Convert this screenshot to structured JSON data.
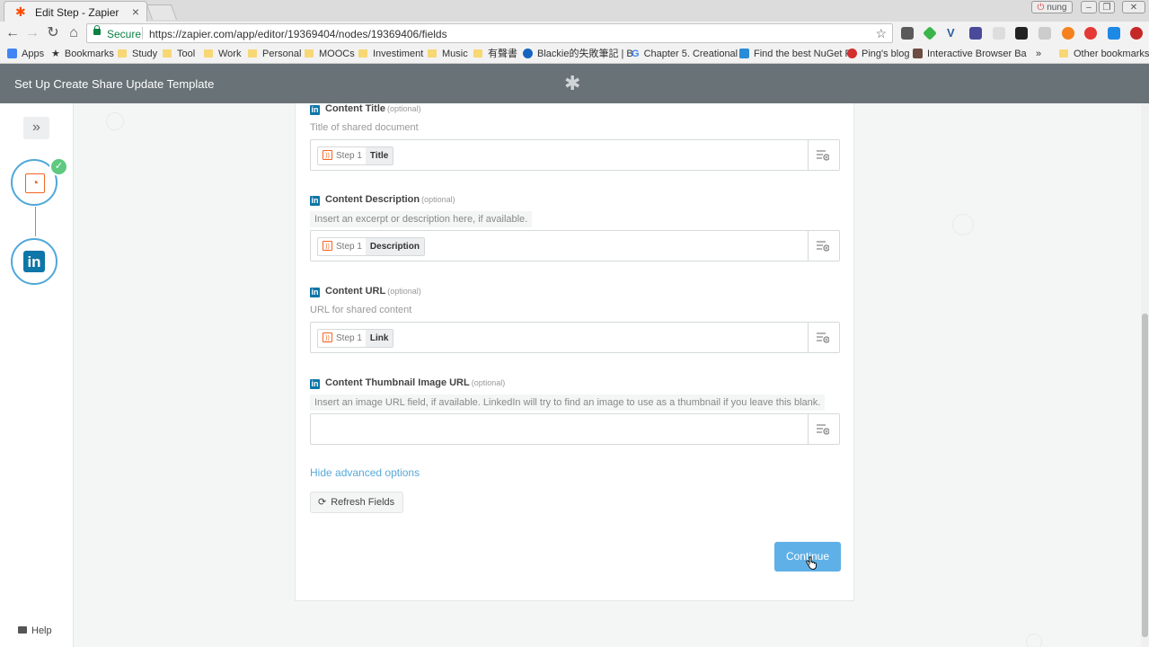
{
  "browser": {
    "tab_title": "Edit Step - Zapier",
    "window_user": "nung",
    "secure_label": "Secure",
    "url": "https://zapier.com/app/editor/19369404/nodes/19369406/fields",
    "bookmarks": [
      "Apps",
      "Bookmarks",
      "Study",
      "Tool",
      "Work",
      "Personal",
      "MOOCs",
      "Investiment",
      "Music",
      "有聲書",
      "Blackie的失敗筆記 | B",
      "Chapter 5. Creational",
      "Find the best NuGet P",
      "Ping's blog",
      "Interactive Browser Ba"
    ],
    "bookmarks_overflow": "»",
    "other_bookmarks": "Other bookmarks"
  },
  "app": {
    "header_title": "Set Up Create Share Update Template",
    "help_label": "Help"
  },
  "fields": [
    {
      "label": "Content Title",
      "optional": "(optional)",
      "hint": "Title of shared document",
      "step": "Step 1",
      "value": "Title"
    },
    {
      "label": "Content Description",
      "optional": "(optional)",
      "hint": "Insert an excerpt or description here, if available.",
      "step": "Step 1",
      "value": "Description"
    },
    {
      "label": "Content URL",
      "optional": "(optional)",
      "hint": "URL for shared content",
      "step": "Step 1",
      "value": "Link"
    },
    {
      "label": "Content Thumbnail Image URL",
      "optional": "(optional)",
      "hint": "Insert an image URL field, if available. LinkedIn will try to find an image to use as a thumbnail if you leave this blank.",
      "step": "",
      "value": ""
    }
  ],
  "actions": {
    "hide_advanced": "Hide advanced options",
    "refresh": "Refresh Fields",
    "continue": "Continue"
  },
  "colors": {
    "header_bg": "#687277",
    "accent_blue": "#5fb0e6",
    "linkedin_blue": "#0e76a8",
    "rss_orange": "#f26522",
    "success_green": "#5ec97f"
  }
}
